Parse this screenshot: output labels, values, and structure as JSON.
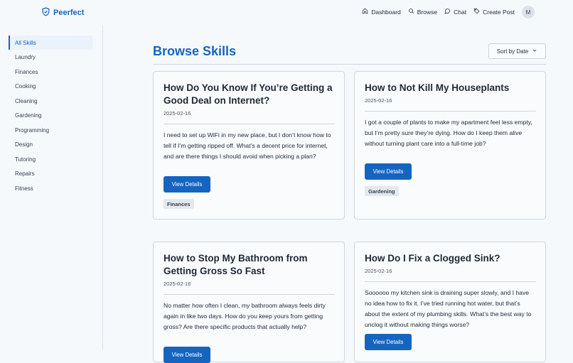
{
  "brand": {
    "name": "Peerfect",
    "logo_icon": "shield-check-icon",
    "accent": "#1565c0"
  },
  "nav": [
    {
      "label": "Dashboard",
      "icon": "home-icon"
    },
    {
      "label": "Browse",
      "icon": "search-icon"
    },
    {
      "label": "Chat",
      "icon": "chat-bubble-icon"
    },
    {
      "label": "Create Post",
      "icon": "tag-icon"
    }
  ],
  "user": {
    "initial": "M"
  },
  "sidebar": {
    "items": [
      {
        "label": "All Skills",
        "active": true
      },
      {
        "label": "Laundry"
      },
      {
        "label": "Finances"
      },
      {
        "label": "Cooking"
      },
      {
        "label": "Cleaning"
      },
      {
        "label": "Gardening"
      },
      {
        "label": "Programming"
      },
      {
        "label": "Design"
      },
      {
        "label": "Tutoring"
      },
      {
        "label": "Repairs"
      },
      {
        "label": "Fitness"
      }
    ]
  },
  "main": {
    "title": "Browse Skills",
    "sort_label": "Sort by Date",
    "cards": [
      {
        "title": "How Do You Know If You’re Getting a Good Deal on Internet?",
        "date": "2025-02-16",
        "description": "I need to set up WiFi in my new place, but I don’t know how to tell if I’m getting ripped off. What’s a decent price for internet, and are there things I should avoid when picking a plan?",
        "button": "View Details",
        "tag": "Finances"
      },
      {
        "title": "How to Not Kill My Houseplants",
        "date": "2025-02-16",
        "description": "I got a couple of plants to make my apartment feel less empty, but I’m pretty sure they’re dying. How do I keep them alive without turning plant care into a full-time job?",
        "button": "View Details",
        "tag": "Gardening"
      },
      {
        "title": "How to Stop My Bathroom from Getting Gross So Fast",
        "date": "2025-02-16",
        "description": "No matter how often I clean, my bathroom always feels dirty again in like two days. How do you keep yours from getting gross? Are there specific products that actually help?",
        "button": "View Details",
        "tag": ""
      },
      {
        "title": "How Do I Fix a Clogged Sink?",
        "date": "2025-02-16",
        "description": "Soooooo my kitchen sink is draining super slowly, and I have no idea how to fix it. I’ve tried running hot water, but that’s about the extent of my plumbing skills. What’s the best way to unclog it without making things worse?",
        "button": "View Details",
        "tag": ""
      }
    ]
  }
}
